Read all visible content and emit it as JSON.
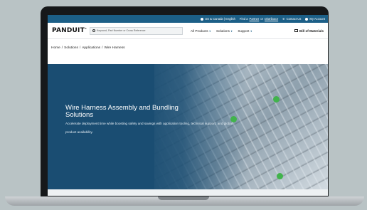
{
  "utility_bar": {
    "region": "US & Canada | English",
    "find_prefix": "Find a",
    "partner": "Partner",
    "or_text": "or",
    "distributor": "Distributor",
    "contact": "Contact Us",
    "account": "My Account"
  },
  "header": {
    "logo": "PANDUIT",
    "search_placeholder": "Keyword, Part Number or Cross Reference",
    "nav": [
      "All Products",
      "Solutions",
      "Support"
    ],
    "bill_of_materials": "Bill of Materials"
  },
  "breadcrumb": [
    "Home",
    "Solutions",
    "Applications",
    "Wire Harness"
  ],
  "hero": {
    "title": "Wire Harness Assembly and Bundling Solutions",
    "subtitle": "Accelerate deployment time while boosting safety and savings with application tooling, technical support, and global product availability."
  },
  "colors": {
    "brand_blue": "#1c5f87",
    "hero_blue": "#1a4d72",
    "accent_green": "#41b34c"
  }
}
